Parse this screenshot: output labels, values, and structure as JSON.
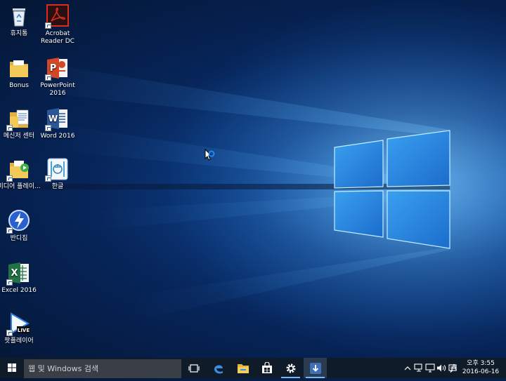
{
  "desktop": {
    "icons": [
      {
        "label": "휴지통",
        "icon": "recycle-bin-icon",
        "shortcut": false
      },
      {
        "label": "Acrobat Reader DC",
        "icon": "acrobat-reader-icon",
        "shortcut": true
      },
      {
        "label": "Bonus",
        "icon": "folder-icon",
        "shortcut": false
      },
      {
        "label": "PowerPoint 2016",
        "icon": "powerpoint-icon",
        "shortcut": true
      },
      {
        "label": "메신저 센터",
        "icon": "folder-document-icon",
        "shortcut": true
      },
      {
        "label": "Word 2016",
        "icon": "word-icon",
        "shortcut": true
      },
      {
        "label": "미디어 플레이...",
        "icon": "media-player-folder-icon",
        "shortcut": true
      },
      {
        "label": "한글",
        "icon": "hangul-icon",
        "shortcut": true
      },
      {
        "label": "반디집",
        "icon": "bandizip-icon",
        "shortcut": true
      },
      {
        "label": "Excel 2016",
        "icon": "excel-icon",
        "shortcut": true
      },
      {
        "label": "팟플레이어",
        "icon": "potplayer-icon",
        "shortcut": true,
        "badge": "LIVE"
      }
    ]
  },
  "taskbar": {
    "search_placeholder": "웹 및 Windows 검색",
    "pinned": [
      {
        "name": "task-view-icon",
        "active": false
      },
      {
        "name": "edge-icon",
        "active": false
      },
      {
        "name": "file-explorer-icon",
        "active": false
      },
      {
        "name": "store-icon",
        "active": false
      },
      {
        "name": "settings-icon",
        "active": true
      },
      {
        "name": "download-app-icon",
        "active": true
      }
    ],
    "tray": {
      "ime_label": "A",
      "time": "오후 3:55",
      "date": "2016-06-16"
    }
  },
  "colors": {
    "taskbar_bg": "#101b2a",
    "search_bg": "#3a3f47",
    "accent": "#76b9ed",
    "wallpaper_glow": "#2a7fd8"
  }
}
